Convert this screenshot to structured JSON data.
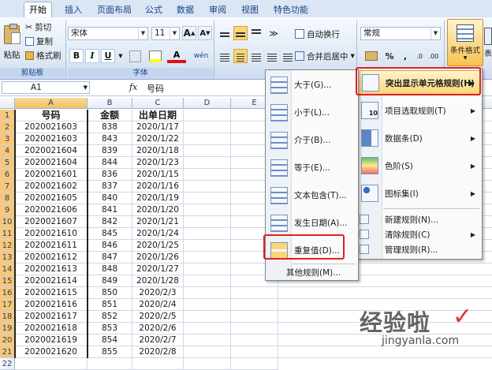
{
  "tabs": [
    "开始",
    "插入",
    "页面布局",
    "公式",
    "数据",
    "审阅",
    "视图",
    "特色功能"
  ],
  "ribbon": {
    "paste_label": "粘贴",
    "cut_label": "剪切",
    "copy_label": "复制",
    "format_painter_label": "格式刷",
    "clipboard_group": "剪贴板",
    "font_name": "宋体",
    "font_size": "11",
    "font_group": "字体",
    "bold": "B",
    "italic": "I",
    "underline": "U",
    "font_color_letter": "A",
    "wen_label": "wén",
    "wrap_text_label": "自动换行",
    "merge_center_label": "合并后居中",
    "number_format": "常规",
    "percent_label": "%",
    "comma_label": ",",
    "cond_format_label": "条件格式",
    "table_label": "表"
  },
  "formula_bar": {
    "name_box": "A1",
    "fx": "fx",
    "content": "号码"
  },
  "grid": {
    "columns": [
      "A",
      "B",
      "C",
      "D",
      "E"
    ],
    "headers": [
      "号码",
      "金额",
      "出单日期"
    ],
    "rows": [
      [
        "2020021603",
        "838",
        "2020/1/17"
      ],
      [
        "2020021603",
        "843",
        "2020/1/22"
      ],
      [
        "2020021604",
        "839",
        "2020/1/18"
      ],
      [
        "2020021604",
        "844",
        "2020/1/23"
      ],
      [
        "2020021601",
        "836",
        "2020/1/15"
      ],
      [
        "2020021602",
        "837",
        "2020/1/16"
      ],
      [
        "2020021605",
        "840",
        "2020/1/19"
      ],
      [
        "2020021606",
        "841",
        "2020/1/20"
      ],
      [
        "2020021607",
        "842",
        "2020/1/21"
      ],
      [
        "2020021610",
        "845",
        "2020/1/24"
      ],
      [
        "2020021611",
        "846",
        "2020/1/25"
      ],
      [
        "2020021612",
        "847",
        "2020/1/26"
      ],
      [
        "2020021613",
        "848",
        "2020/1/27"
      ],
      [
        "2020021614",
        "849",
        "2020/1/28"
      ],
      [
        "2020021615",
        "850",
        "2020/2/3"
      ],
      [
        "2020021616",
        "851",
        "2020/2/4"
      ],
      [
        "2020021617",
        "852",
        "2020/2/5"
      ],
      [
        "2020021618",
        "853",
        "2020/2/6"
      ],
      [
        "2020021619",
        "854",
        "2020/2/7"
      ],
      [
        "2020021620",
        "855",
        "2020/2/8"
      ]
    ],
    "row_numbers": [
      "1",
      "2",
      "3",
      "4",
      "5",
      "6",
      "7",
      "8",
      "9",
      "10",
      "11",
      "12",
      "13",
      "14",
      "15",
      "16",
      "17",
      "18",
      "19",
      "20",
      "21",
      "22"
    ]
  },
  "cond_menu": {
    "items": [
      {
        "label": "突出显示单元格规则(H)",
        "icon": "highlight-rules-icon"
      },
      {
        "label": "项目选取规则(T)",
        "icon": "top-ten-icon"
      },
      {
        "label": "数据条(D)",
        "icon": "data-bars-icon"
      },
      {
        "label": "色阶(S)",
        "icon": "color-scales-icon"
      },
      {
        "label": "图标集(I)",
        "icon": "icon-sets-icon"
      },
      {
        "label": "新建规则(N)...",
        "icon": "new-rule-icon"
      },
      {
        "label": "清除规则(C)",
        "icon": "clear-rules-icon"
      },
      {
        "label": "管理规则(R)...",
        "icon": "manage-rules-icon"
      }
    ],
    "top_ten_badge": "10"
  },
  "sub_menu": {
    "items": [
      {
        "label": "大于(G)...",
        "icon": "greater-than-icon"
      },
      {
        "label": "小于(L)...",
        "icon": "less-than-icon"
      },
      {
        "label": "介于(B)...",
        "icon": "between-icon"
      },
      {
        "label": "等于(E)...",
        "icon": "equal-to-icon"
      },
      {
        "label": "文本包含(T)...",
        "icon": "text-contains-icon"
      },
      {
        "label": "发生日期(A)...",
        "icon": "date-occurring-icon"
      },
      {
        "label": "重复值(D)...",
        "icon": "duplicate-values-icon"
      }
    ],
    "more_rules": "其他规则(M)..."
  },
  "watermark": {
    "line1": "经验啦",
    "line2": "jingyanla.com"
  }
}
